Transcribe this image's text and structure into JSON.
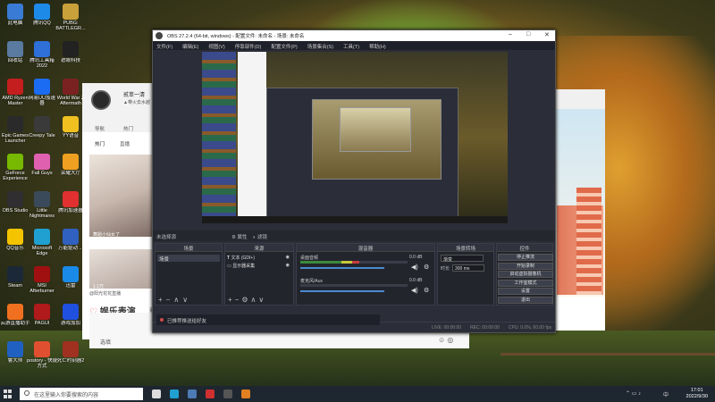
{
  "desktop": {
    "icons": [
      {
        "label": "此电脑",
        "color": "#3a7bd5"
      },
      {
        "label": "腾讯QQ",
        "color": "#1d8ae8"
      },
      {
        "label": "PUBG: BATTLEGR...",
        "color": "#c9a13a"
      },
      {
        "label": "回收站",
        "color": "#5a7aa0"
      },
      {
        "label": "腾讯工具箱 2022",
        "color": "#2f6fd8"
      },
      {
        "label": "遮眼科技",
        "color": "#222222"
      },
      {
        "label": "AMD Ryzen Master",
        "color": "#c41e1e"
      },
      {
        "label": "网易UU加速器",
        "color": "#1b6cf2"
      },
      {
        "label": "World War Z Aftermath",
        "color": "#7a2222"
      },
      {
        "label": "Epic Games Launcher",
        "color": "#2a2a2a"
      },
      {
        "label": "Creepy Tale",
        "color": "#3a3a3a"
      },
      {
        "label": "YY语音",
        "color": "#f0c020"
      },
      {
        "label": "GeForce Experience",
        "color": "#76b900"
      },
      {
        "label": "Fall Guys",
        "color": "#e060b0"
      },
      {
        "label": "荣耀大厅",
        "color": "#f0a020"
      },
      {
        "label": "OBS Studio",
        "color": "#302e31"
      },
      {
        "label": "Little Nightmares",
        "color": "#3a4a5a"
      },
      {
        "label": "腾讯加速器",
        "color": "#e03030"
      },
      {
        "label": "QQ音乐",
        "color": "#f5c400"
      },
      {
        "label": "Microsoft Edge",
        "color": "#1fa0d0"
      },
      {
        "label": "万能驱动 ...",
        "color": "#3060c0"
      },
      {
        "label": "Steam",
        "color": "#1b2838"
      },
      {
        "label": "MSI Afterburner",
        "color": "#a01010"
      },
      {
        "label": "迅雷",
        "color": "#1a8ae8"
      },
      {
        "label": "云游直播助手",
        "color": "#f07020"
      },
      {
        "label": "PAGUI",
        "color": "#b01a1a"
      },
      {
        "label": "游戏加加",
        "color": "#2050e0"
      },
      {
        "label": "鲁大师",
        "color": "#2060c0"
      },
      {
        "label": "postory - 快捷方式",
        "color": "#e05030"
      },
      {
        "label": "死亡时刻器2",
        "color": "#a03020"
      }
    ]
  },
  "bg_app": {
    "username": "贰萃一清",
    "subtitle": "▲带火去水越",
    "nav": [
      "导航",
      "热门"
    ],
    "subnav": [
      "热门",
      "直播"
    ],
    "item1_caption": "舞蹈小仙女了",
    "item1_stats": "1.1万 · 5782",
    "item2_stats": "1.1万",
    "item2_caption": "@阳光花花直播",
    "emote_label": "娱乐表演",
    "emote_more": "更多"
  },
  "chat_app": {
    "input_hint": "选填"
  },
  "obs": {
    "title": "OBS 27.2.4 (64-bit, windows) - 配置文件: 未命名 - 场景: 未命名",
    "menu": [
      "文件(F)",
      "编辑(E)",
      "视图(V)",
      "停靠部件(D)",
      "配置文件(P)",
      "场景集合(S)",
      "工具(T)",
      "帮助(H)"
    ],
    "no_source_label": "未选择源",
    "props_btn": "属性",
    "filters_btn": "滤镜",
    "scenes_header": "场景",
    "scenes": [
      "场景"
    ],
    "sources_header": "来源",
    "sources": [
      {
        "name": "文本 (GDI+)"
      },
      {
        "name": "显示器采集"
      }
    ],
    "mixer_header": "混音器",
    "mixer_channels": [
      {
        "name": "桌面音频",
        "db": "0.0 dB",
        "meter": 0.55,
        "volume": 0.78
      },
      {
        "name": "麦克风/Aux",
        "db": "0.0 dB",
        "meter": 0.0,
        "volume": 0.78
      }
    ],
    "transitions_header": "场景转场",
    "transition_value": "渐变",
    "duration_label": "时长",
    "duration_value": "300 ms",
    "controls_header": "控件",
    "controls": [
      "停止推流",
      "开始录制",
      "启动虚拟摄像机",
      "工作室模式",
      "设置",
      "退出"
    ],
    "status": [
      "LIVE: 00:00:00",
      "REC: 00:00:00",
      "CPU: 0.0%, 60.00 fps"
    ],
    "notification": "已推荐推送给好友"
  },
  "taskbar": {
    "search_placeholder": "在这里输入你要搜索的内容",
    "time": "17:01",
    "date": "2022/9/30",
    "lang": "中",
    "pinned": [
      {
        "name": "task-view-icon",
        "color": "#dddddd"
      },
      {
        "name": "edge-icon",
        "color": "#1fa0d0"
      },
      {
        "name": "steam-icon",
        "color": "#4c7bb5"
      },
      {
        "name": "netease-icon",
        "color": "#d03030"
      },
      {
        "name": "obs-icon",
        "color": "#555555"
      },
      {
        "name": "qq-icon",
        "color": "#e08020"
      }
    ]
  }
}
